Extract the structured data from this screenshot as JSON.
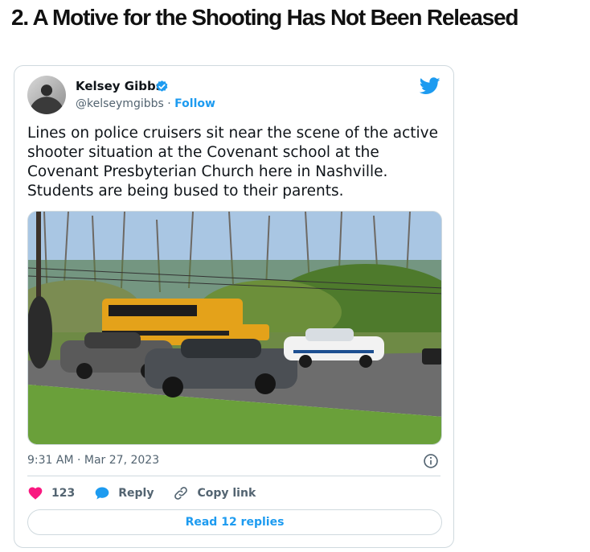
{
  "article": {
    "heading": "2. A Motive for the Shooting Has Not Been Released"
  },
  "tweet": {
    "author_name": "Kelsey Gibbs",
    "handle": "@kelseymgibbs",
    "separator": "·",
    "follow_label": "Follow",
    "text": "Lines on police cruisers sit near the scene of the active shooter situation at the Covenant school at the Covenant Presbyterian Church here in Nashville. Students are being bused to their parents.",
    "timestamp": "9:31 AM · Mar 27, 2023",
    "likes_count": "123",
    "reply_label": "Reply",
    "copy_link_label": "Copy link",
    "read_replies_label": "Read 12 replies",
    "icons": {
      "verified": "verified-badge-icon",
      "brand": "twitter-bird-icon",
      "info": "info-icon",
      "like": "heart-icon",
      "reply": "speech-bubble-icon",
      "copy_link": "link-icon"
    },
    "colors": {
      "accent": "#1d9bf0",
      "like": "#f91880",
      "muted_text": "#536471",
      "border": "#cfd9de"
    }
  }
}
